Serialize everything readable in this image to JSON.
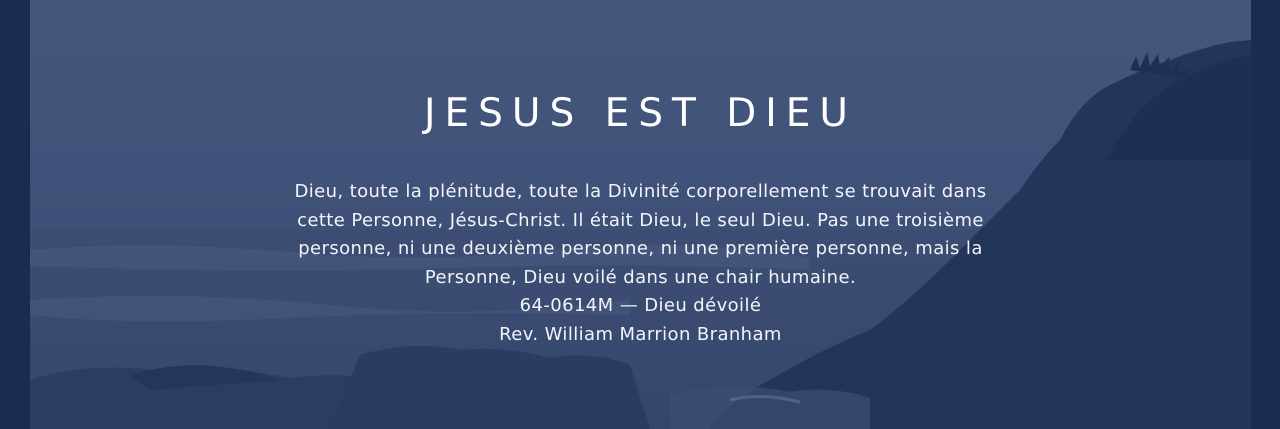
{
  "colors": {
    "frame": "#1b2c52",
    "overlay": "#46577a",
    "text": "#ffffff"
  },
  "banner": {
    "title": "JESUS EST DIEU",
    "quote": "Dieu, toute la plénitude, toute la Divinité corporellement se trouvait dans cette Personne, Jésus-Christ. Il était Dieu, le seul Dieu. Pas une troisième personne, ni une deuxième personne, ni une première personne, mais la Personne, Dieu voilé dans une chair humaine.",
    "reference": "64-0614M — Dieu dévoilé",
    "author": "Rev. William Marrion Branham"
  }
}
